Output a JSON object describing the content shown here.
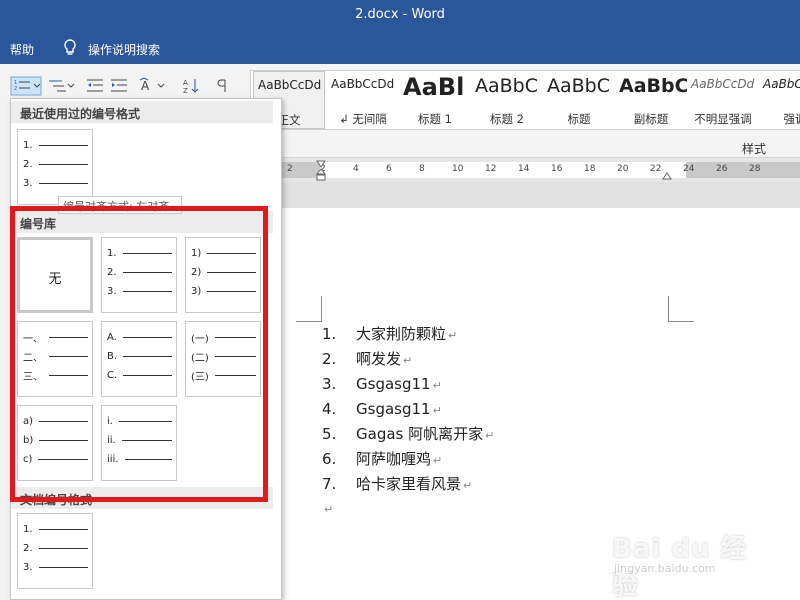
{
  "window": {
    "title": "2.docx  -  Word",
    "brand_color": "#2b579a"
  },
  "menubar": {
    "help": "帮助",
    "tell_me": "操作说明搜索",
    "tell_me_icon": "lightbulb-icon"
  },
  "ribbon": {
    "styles_group_label": "样式",
    "styles": [
      {
        "preview": "AaBbCcDd",
        "name": "正文",
        "selected": true
      },
      {
        "preview": "AaBbCcDd",
        "name": "↲ 无间隔"
      },
      {
        "preview": "AaBl",
        "name": "标题 1"
      },
      {
        "preview": "AaBbC",
        "name": "标题 2"
      },
      {
        "preview": "AaBbC",
        "name": "标题"
      },
      {
        "preview": "AaBbC",
        "name": "副标题"
      },
      {
        "preview": "AaBbCcDd",
        "name": "不明显强调"
      },
      {
        "preview": "AaBbCcDd",
        "name": "强调"
      }
    ]
  },
  "numbering_dropdown": {
    "recent_header": "最近使用过的编号格式",
    "recent": [
      [
        "1.",
        "2.",
        "3."
      ]
    ],
    "tooltip": "编号对齐方式: 左对齐",
    "library_header": "编号库",
    "library": [
      {
        "none_label": "无"
      },
      {
        "rows": [
          "1.",
          "2.",
          "3."
        ]
      },
      {
        "rows": [
          "1)",
          "2)",
          "3)"
        ]
      },
      {
        "rows": [
          "一、",
          "二、",
          "三、"
        ]
      },
      {
        "rows": [
          "A.",
          "B.",
          "C."
        ]
      },
      {
        "rows": [
          "(一)",
          "(二)",
          "(三)"
        ]
      },
      {
        "rows": [
          "a)",
          "b)",
          "c)"
        ]
      },
      {
        "rows": [
          "i.",
          "ii.",
          "iii."
        ]
      }
    ],
    "document_header": "文档编号格式",
    "document": [
      [
        "1.",
        "2.",
        "3."
      ]
    ]
  },
  "ruler_ticks": [
    "2",
    "2",
    "4",
    "6",
    "8",
    "10",
    "12",
    "14",
    "16",
    "18",
    "20",
    "22",
    "24",
    "26",
    "28"
  ],
  "document": {
    "numbered_list": [
      {
        "num": "1.",
        "text": "大家荆防颗粒"
      },
      {
        "num": "2.",
        "text": "啊发发"
      },
      {
        "num": "3.",
        "text": "Gsgasg11"
      },
      {
        "num": "4.",
        "text": "Gsgasg11"
      },
      {
        "num": "5.",
        "text": "Gagas 阿帆离开家"
      },
      {
        "num": "6.",
        "text": "阿萨咖喱鸡"
      },
      {
        "num": "7.",
        "text": "哈卡家里看风景"
      }
    ],
    "paragraph_mark": "↵"
  },
  "watermark": {
    "logo": "Bai du 经验",
    "url_text": "jingyan.baidu.com"
  }
}
